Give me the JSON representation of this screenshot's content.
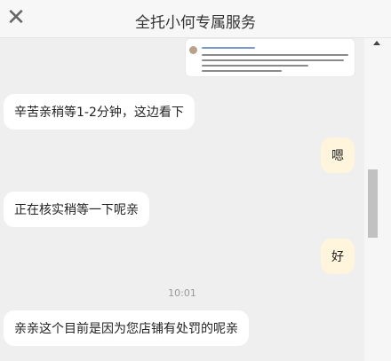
{
  "header": {
    "close_glyph": "✕",
    "title": "全托小何专属服务"
  },
  "chat": {
    "messages": [
      {
        "side": "left",
        "text": "辛苦亲稍等1-2分钟，这边看下"
      },
      {
        "side": "right",
        "text": "嗯"
      },
      {
        "side": "left",
        "text": "正在核实稍等一下呢亲"
      },
      {
        "side": "right",
        "text": "好"
      },
      {
        "side": "left",
        "text": "亲亲这个目前是因为您店铺有处罚的呢亲"
      }
    ],
    "timestamp": "10:01"
  },
  "icons": {
    "close": "close-icon",
    "scroll_up": "scroll-up-arrow-icon"
  },
  "colors": {
    "incoming_bubble": "#ffffff",
    "outgoing_bubble": "#fff5dc",
    "chat_background": "#efefef"
  }
}
